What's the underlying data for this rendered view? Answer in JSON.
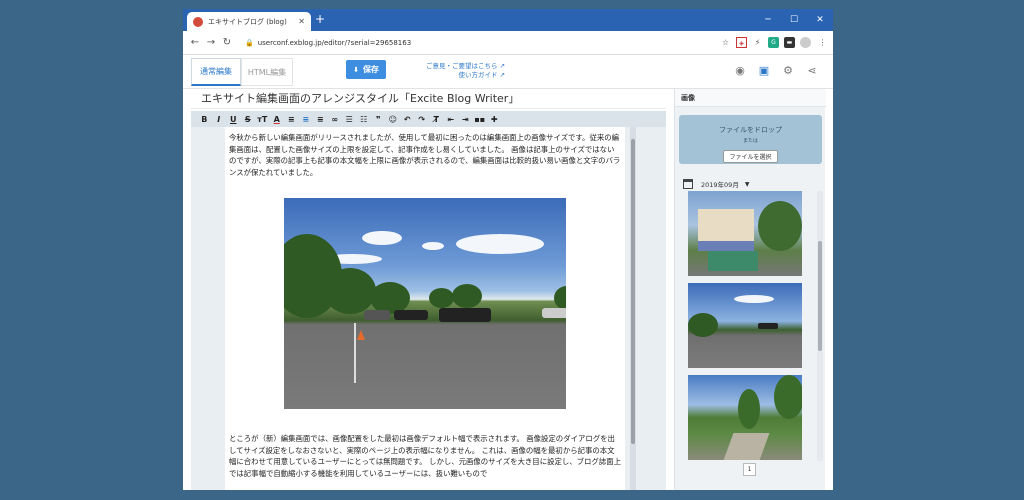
{
  "browser": {
    "tab_title": "エキサイトブログ (blog)",
    "url": "userconf.exblog.jp/editor/?serial=29658163"
  },
  "editor": {
    "mode_normal": "通常編集",
    "mode_html": "HTML編集",
    "save_label": "保存",
    "feedback_link": "ご意見・ご要望はこちら",
    "guide_link": "使い方ガイド",
    "post_title": "エキサイト編集画面のアレンジスタイル「Excite Blog Writer」",
    "paragraph_1": "今秋から新しい編集画面がリリースされましたが、使用して最初に困ったのは編集画面上の画像サイズです。従来の編集画面は、配置した画像サイズの上限を設定して、記事作成をし易くしていました。 画像は記事上のサイズではないのですが、実際の記事上も記事の本文幅を上限に画像が表示されるので、編集画面は比較的扱い易い画像と文字のバランスが保たれていました。",
    "paragraph_2": "ところが（新）編集画面では、画像配置をした最初は画像デフォルト幅で表示されます。 画像設定のダイアログを出してサイズ設定をしなおさないと、実際のページ上の表示幅になりません。 これは、画像の幅を最初から記事の本文幅に合わせて用意しているユーザーにとっては無問題です。 しかし、元画像のサイズを大き目に設定し、ブログ誌面上では記事幅で自動縮小する機能を利用しているユーザーには、扱い難いもので"
  },
  "sidebar": {
    "title": "画像",
    "drop_text": "ファイルをドロップ",
    "or_text": "または",
    "select_button": "ファイルを選択",
    "month": "2019年09月",
    "page": "1"
  }
}
